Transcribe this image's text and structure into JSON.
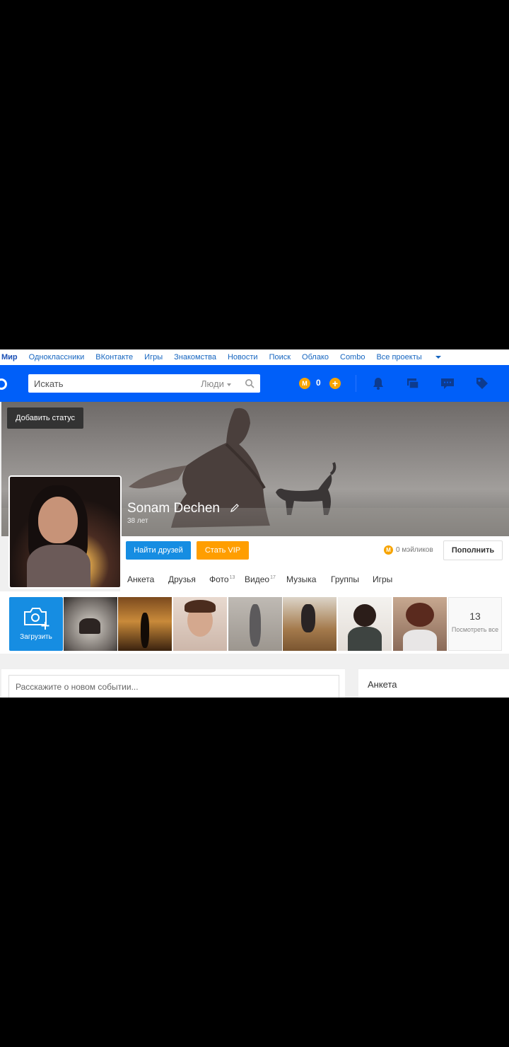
{
  "projects_bar": {
    "items": [
      "Мир",
      "Одноклассники",
      "ВКонтакте",
      "Игры",
      "Знакомства",
      "Новости",
      "Поиск",
      "Облако",
      "Combo",
      "Все проекты"
    ]
  },
  "header": {
    "search_placeholder": "Искать",
    "search_scope": "Люди",
    "coin_symbol": "М",
    "coins_count": "0",
    "plus_symbol": "+",
    "brand_color": "#005ff9"
  },
  "profile": {
    "status_tooltip": "Добавить статус",
    "name": "Sonam Dechen",
    "age": "38 лет",
    "find_friends_label": "Найти друзей",
    "vip_label": "Стать VIP",
    "mailiks_text": "0 мэйликов",
    "topup_label": "Пополнить",
    "tabs": [
      {
        "label": "Анкета",
        "count": ""
      },
      {
        "label": "Друзья",
        "count": ""
      },
      {
        "label": "Фото",
        "count": "13"
      },
      {
        "label": "Видео",
        "count": "17"
      },
      {
        "label": "Музыка",
        "count": ""
      },
      {
        "label": "Группы",
        "count": ""
      },
      {
        "label": "Игры",
        "count": ""
      }
    ]
  },
  "photos": {
    "upload_label": "Загрузить",
    "total_count": "13",
    "view_all_label": "Посмотреть все"
  },
  "feed": {
    "event_placeholder": "Расскажите о новом событии..."
  },
  "sidebar": {
    "anketa_title": "Анкета"
  }
}
